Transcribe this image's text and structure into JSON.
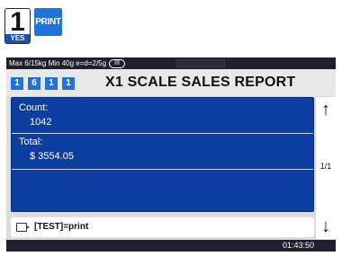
{
  "keys": {
    "yes_number": "1",
    "yes_label": "YES",
    "print_label": "PRINT"
  },
  "status": {
    "capacity_text": "Max 6/15kg Min 40g e=d=2/5g",
    "range_badge": "III"
  },
  "header": {
    "digits": [
      "1",
      "6",
      "1",
      "1"
    ],
    "title": "X1 SCALE SALES REPORT"
  },
  "report": {
    "count_label": "Count:",
    "count_value": "1042",
    "total_label": "Total:",
    "total_value": "$ 3554.05"
  },
  "pager": {
    "page_indicator": "1/1"
  },
  "info": {
    "message": "[TEST]=print"
  },
  "footer": {
    "time": "01:43:50"
  },
  "colors": {
    "accent_blue": "#1f73d9",
    "panel_blue": "#0c3ea1",
    "status_dark": "#1f1f2e"
  },
  "icons": {
    "up": "arrow-up-icon",
    "down": "arrow-down-icon",
    "info": "message-icon"
  }
}
